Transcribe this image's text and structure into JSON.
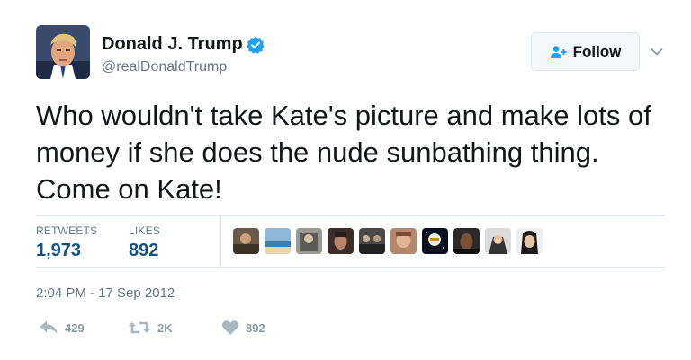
{
  "user": {
    "name": "Donald J. Trump",
    "handle": "@realDonaldTrump",
    "verified": true
  },
  "follow_button": {
    "label": "Follow"
  },
  "tweet": {
    "text": "Who wouldn't take Kate's picture and make lots of money if she does the nude sunbathing thing. Come on Kate!"
  },
  "stats": {
    "retweets_label": "RETWEETS",
    "retweets_value": "1,973",
    "likes_label": "LIKES",
    "likes_value": "892"
  },
  "likers_count": 10,
  "timestamp": "2:04 PM - 17 Sep 2012",
  "actions": {
    "reply_count": "429",
    "retweet_count": "2K",
    "like_count": "892"
  },
  "colors": {
    "text": "#14171a",
    "muted": "#657786",
    "verified_blue": "#1da1f2",
    "follow_icon_blue": "#1da1f2",
    "stat_value": "#14517e"
  }
}
